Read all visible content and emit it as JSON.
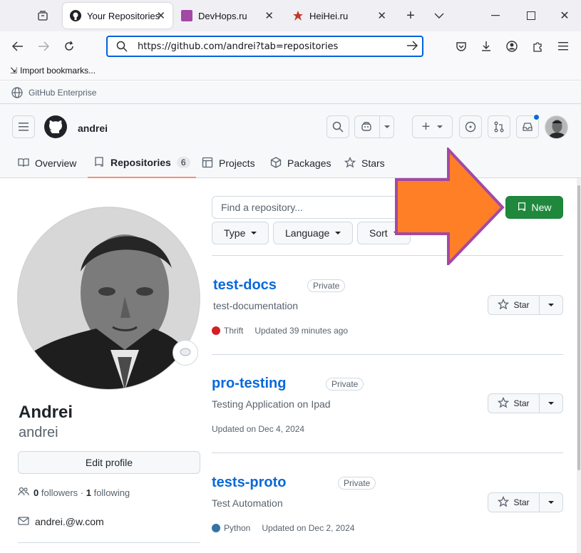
{
  "browser": {
    "tabs": [
      {
        "label": "Your Repositories",
        "active": true
      },
      {
        "label": "DevHops.ru",
        "active": false
      },
      {
        "label": "HeiHei.ru",
        "active": false
      }
    ],
    "url": "https://github.com/andrei?tab=repositories",
    "bookmark_import": "Import bookmarks...",
    "enterprise_label": "GitHub Enterprise"
  },
  "header": {
    "username": "andrei",
    "nav": {
      "overview": "Overview",
      "repositories": "Repositories",
      "repo_count": "6",
      "projects": "Projects",
      "packages": "Packages",
      "stars": "Stars"
    }
  },
  "profile": {
    "fullname": "Andrei",
    "login": "andrei",
    "edit_label": "Edit profile",
    "followers": "0",
    "followers_label": "followers",
    "following": "1",
    "following_label": "following",
    "email": "andrei.@w.com"
  },
  "repo_list": {
    "search_placeholder": "Find a repository...",
    "filters": {
      "type": "Type",
      "language": "Language",
      "sort": "Sort"
    },
    "new_label": "New",
    "repos": [
      {
        "name": "test-docs",
        "visibility": "Private",
        "description": "test-documentation",
        "language": "Thrift",
        "language_color": "#d12127",
        "updated": "Updated 39 minutes ago",
        "star_label": "Star"
      },
      {
        "name": "pro-testing",
        "visibility": "Private",
        "description": "Testing Application on Ipad",
        "language": "",
        "language_color": "",
        "updated": "Updated on Dec 4, 2024",
        "star_label": "Star"
      },
      {
        "name": "tests-proto",
        "visibility": "Private",
        "description": "Test Automation",
        "language": "Python",
        "language_color": "#3572a5",
        "updated": "Updated on Dec 2, 2024",
        "star_label": "Star"
      }
    ]
  },
  "colors": {
    "accent": "#0969da",
    "primary_button": "#1f883d",
    "arrow": "#ff7f27",
    "arrow_border": "#a349a4"
  }
}
